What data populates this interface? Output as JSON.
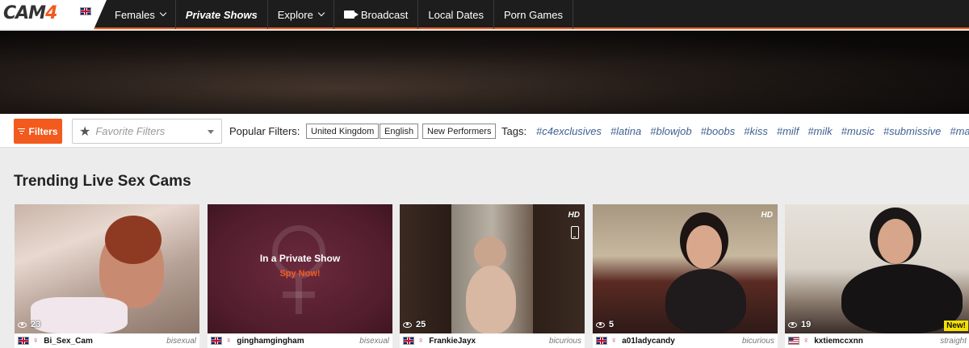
{
  "brand": {
    "logo_main": "CAM",
    "logo_accent": "4"
  },
  "nav": {
    "items": [
      {
        "label": "Females",
        "dropdown": true
      },
      {
        "label": "Private Shows",
        "dropdown": false
      },
      {
        "label": "Explore",
        "dropdown": true
      },
      {
        "label": "Broadcast",
        "dropdown": false
      },
      {
        "label": "Local Dates",
        "dropdown": false
      },
      {
        "label": "Porn Games",
        "dropdown": false
      }
    ]
  },
  "filterbar": {
    "filters_label": "Filters",
    "favorite_placeholder": "Favorite Filters",
    "popular_label": "Popular Filters:",
    "chips": [
      "United Kingdom",
      "English",
      "New Performers"
    ],
    "tags_label": "Tags:",
    "tags": [
      "#c4exclusives",
      "#latina",
      "#blowjob",
      "#boobs",
      "#kiss",
      "#milf",
      "#milk",
      "#music",
      "#submissive",
      "#ma"
    ]
  },
  "section": {
    "title": "Trending Live Sex Cams"
  },
  "cards": [
    {
      "viewers": "23",
      "username": "Bi_Sex_Cam",
      "orientation": "bisexual",
      "flag": "uk",
      "hd": false,
      "new": false
    },
    {
      "private_title": "In a Private Show",
      "private_cta": "Spy Now!",
      "username": "ginghamgingham",
      "orientation": "bisexual",
      "flag": "uk"
    },
    {
      "viewers": "25",
      "username": "FrankieJayx",
      "orientation": "bicurious",
      "flag": "uk",
      "hd": "HD",
      "new": false
    },
    {
      "viewers": "5",
      "username": "a01ladycandy",
      "orientation": "bicurious",
      "flag": "uk",
      "hd": "HD",
      "new": false
    },
    {
      "viewers": "19",
      "username": "kxtiemccxnn",
      "orientation": "straight",
      "flag": "us",
      "hd": false,
      "new": "New!"
    }
  ],
  "colors": {
    "accent": "#f25a1e",
    "nav_bg": "#1d1d1d",
    "tag": "#3f5f92",
    "female": "#d0338a"
  }
}
